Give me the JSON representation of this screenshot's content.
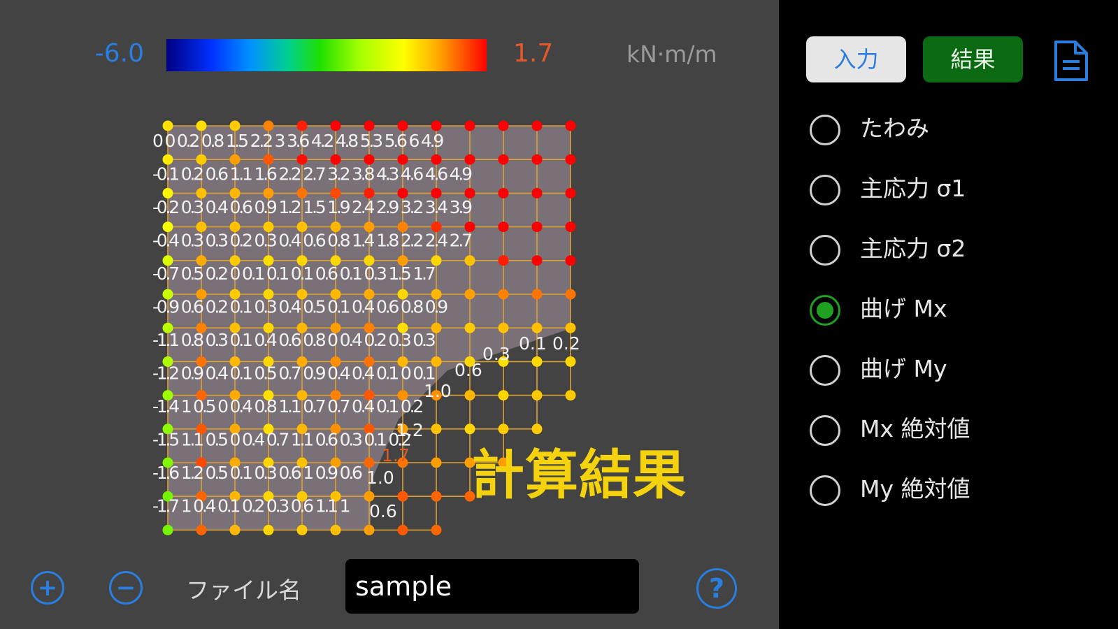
{
  "legend": {
    "min_label": "-6.0",
    "max_label": "1.7",
    "unit": "kN·m/m",
    "min_value": -6.0,
    "max_value": 1.7
  },
  "canvas": {
    "result_title": "計算結果",
    "mesh_value_rows": [
      "0.0 0.0 0.2 0.8 1.5 2.2 3.0 3.6 4.2 4.8 5.3 5.6 6.0 4.9",
      "-0.1 0.2 0.6 1.1 1.6 2.2 2.7 3.2 3.8 4.3 4.6 4.6 4.9",
      "-0.2 0.3 0.4 0.6 0.9 1.2 1.5 1.9 2.4 2.9 3.2 3.4 3.9",
      "-0.4 0.3 0.3 0.2 0.3 0.4 0.6 0.8 1.4 1.8 2.2 2.4 2.7",
      "-0.7 0.5 0.2 0.0 0.1 0.1 0.1 0.6 0.1 0.3 1.5 1.7",
      "-0.9 0.6 0.2 0.1 0.3 0.4 0.5 0.1 0.4 0.6 0.8 0.9",
      "-1.1 0.8 0.3 0.1 0.4 0.6 0.8 0.0 0.4 0.2 0.3 0.3",
      "-1.2 0.9 0.4 0.1 0.5 0.7 0.9 0.4 0.4 0.1 0.0 0.1",
      "-1.4 1.0 0.5 0.0 0.4 0.8 1.1 0.7 0.7 0.4 0.1 0.2",
      "-1.5 1.1 0.5 0.0 0.4 0.7 1.1 0.6 0.3 0.1 0.2",
      "-1.6 1.2 0.5 0.1 0.3 0.6 1.0 0.9 0.6",
      "-1.7 1.0 0.4 0.1 0.2 0.3 0.6 1.1 1.0"
    ],
    "extra_value_labels": [
      "0.3",
      "0.1",
      "0.2",
      "0.6",
      "1.0",
      "1.2",
      "1.7",
      "1.0",
      "0.6"
    ]
  },
  "bottom_bar": {
    "zoom_in_icon": "plus-circle-icon",
    "zoom_out_icon": "minus-circle-icon",
    "zoom_in_glyph": "+",
    "zoom_out_glyph": "−",
    "filename_label": "ファイル名",
    "filename_value": "sample",
    "help_glyph": "?",
    "help_icon": "question-circle-icon"
  },
  "sidebar": {
    "tab_input": "入力",
    "tab_result": "結果",
    "doc_icon": "document-icon",
    "options": [
      {
        "label": "たわみ",
        "selected": false
      },
      {
        "label": "主応力 σ1",
        "selected": false
      },
      {
        "label": "主応力 σ2",
        "selected": false
      },
      {
        "label": "曲げ Mx",
        "selected": true
      },
      {
        "label": "曲げ My",
        "selected": false
      },
      {
        "label": "Mx 絶対値",
        "selected": false
      },
      {
        "label": "My 絶対値",
        "selected": false
      }
    ]
  },
  "colors": {
    "canvas_bg": "#434343",
    "accent_blue": "#2a7ee0",
    "result_green": "#0c6a12",
    "title_yellow": "#f4d20e",
    "radio_selected": "#1fa020"
  }
}
